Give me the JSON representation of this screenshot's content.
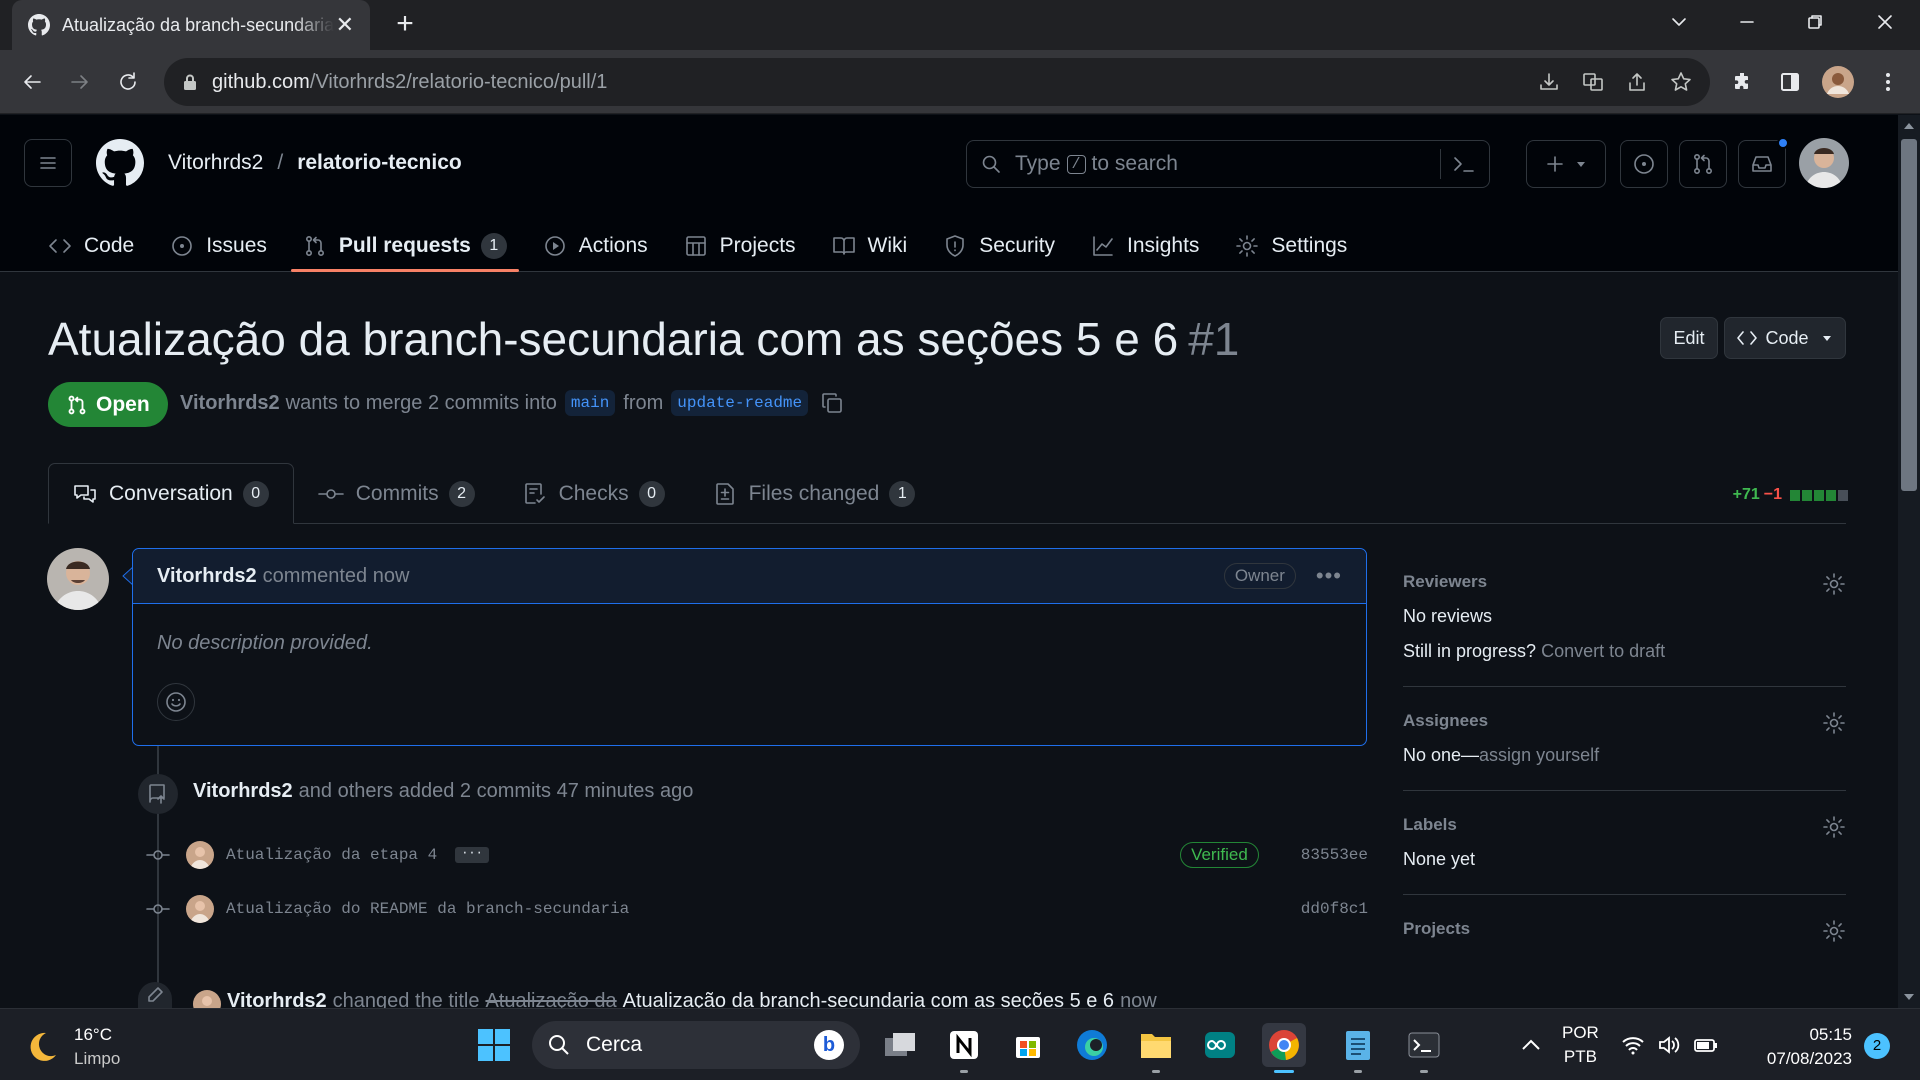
{
  "browser": {
    "tab_title": "Atualização da branch-secundaria com as seções 5 e 6",
    "url_host": "github.com",
    "url_path": "/Vitorhrds2/relatorio-tecnico/pull/1"
  },
  "github": {
    "owner": "Vitorhrds2",
    "repo": "relatorio-tecnico",
    "search_prefix": "Type",
    "search_key": "/",
    "search_suffix": "to search",
    "nav": [
      {
        "label": "Code"
      },
      {
        "label": "Issues"
      },
      {
        "label": "Pull requests",
        "count": "1"
      },
      {
        "label": "Actions"
      },
      {
        "label": "Projects"
      },
      {
        "label": "Wiki"
      },
      {
        "label": "Security"
      },
      {
        "label": "Insights"
      },
      {
        "label": "Settings"
      }
    ]
  },
  "pr": {
    "title": "Atualização da branch-secundaria com as seções 5 e 6",
    "number": "#1",
    "edit_label": "Edit",
    "code_label": "Code",
    "state": "Open",
    "author": "Vitorhrds2",
    "merge_text": "wants to merge 2 commits into",
    "base_branch": "main",
    "from_text": "from",
    "head_branch": "update-readme",
    "tabs": [
      {
        "label": "Conversation",
        "count": "0"
      },
      {
        "label": "Commits",
        "count": "2"
      },
      {
        "label": "Checks",
        "count": "0"
      },
      {
        "label": "Files changed",
        "count": "1"
      }
    ],
    "additions": "+71",
    "deletions": "−1",
    "comment": {
      "author": "Vitorhrds2",
      "when": "commented now",
      "role": "Owner",
      "body": "No description provided."
    },
    "timeline": {
      "commits_event_author": "Vitorhrds2",
      "commits_event_text": "and others added 2 commits 47 minutes ago",
      "commits": [
        {
          "message": "Atualização da etapa 4",
          "sha": "83553ee",
          "verified": "Verified"
        },
        {
          "message": "Atualização do README da branch-secundaria",
          "sha": "dd0f8c1"
        }
      ],
      "rename_author": "Vitorhrds2",
      "rename_text": "changed the title",
      "old_title": "Atualização da",
      "new_title": "Atualização da branch-secundaria com as seções 5 e 6",
      "rename_when": "now"
    }
  },
  "sidebar": {
    "reviewers_heading": "Reviewers",
    "reviewers_value": "No reviews",
    "still_in_progress": "Still in progress?",
    "convert_to_draft": "Convert to draft",
    "assignees_heading": "Assignees",
    "assignees_none": "No one—",
    "assign_yourself": "assign yourself",
    "labels_heading": "Labels",
    "labels_value": "None yet",
    "projects_heading": "Projects"
  },
  "taskbar": {
    "temperature": "16°C",
    "weather": "Limpo",
    "search_label": "Cerca",
    "lang_1": "POR",
    "lang_2": "PTB",
    "time": "05:15",
    "date": "07/08/2023",
    "notifications": "2"
  }
}
